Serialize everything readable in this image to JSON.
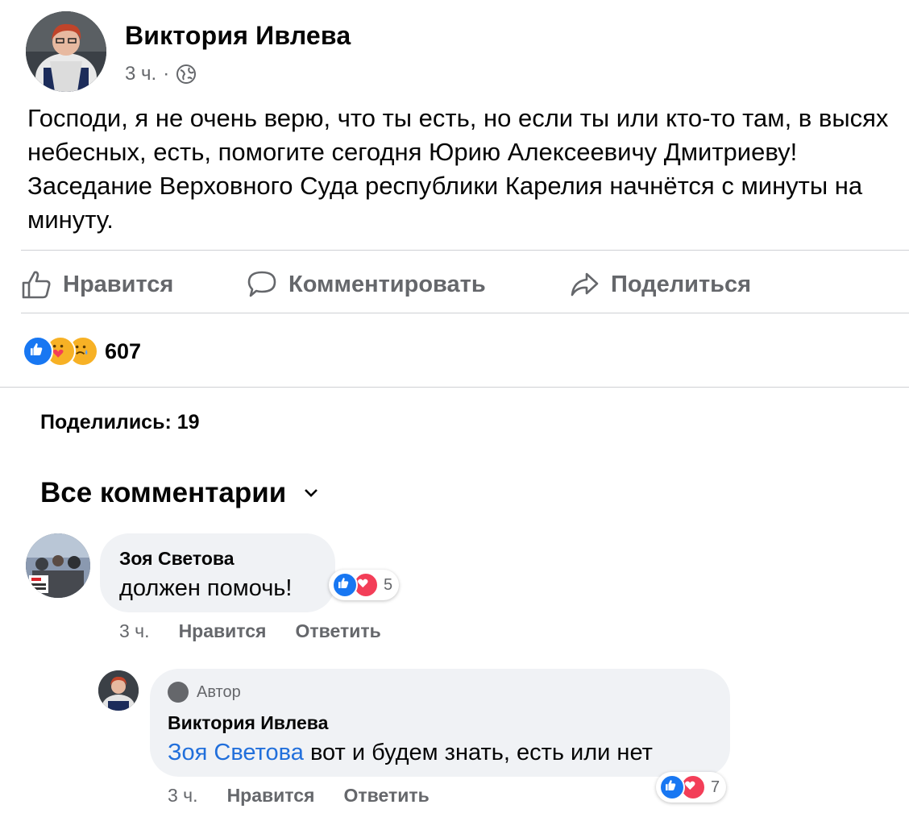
{
  "post": {
    "author": "Виктория Ивлева",
    "time": "3 ч.",
    "separator": "·",
    "privacy_icon": "globe-icon",
    "text": "Господи, я не очень верю, что ты есть, но если ты или кто-то там, в высях небесных, есть, помогите сегодня Юрию Алексеевичу Дмитриеву! Заседание Верховного Суда республики Карелия начнётся с минуты на минуту."
  },
  "actions": {
    "like": "Нравится",
    "comment": "Комментировать",
    "share": "Поделиться"
  },
  "reactions": {
    "icons": [
      "like-reaction-icon",
      "care-reaction-icon",
      "sad-reaction-icon"
    ],
    "count": "607"
  },
  "shares": "Поделились: 19",
  "comments_header": "Все комментарии",
  "comments": [
    {
      "name": "Зоя Светова",
      "text": "должен помочь!",
      "reactions_count": "5",
      "time": "3 ч.",
      "like": "Нравится",
      "reply": "Ответить"
    }
  ],
  "reply": {
    "badge": "Автор",
    "name": "Виктория Ивлева",
    "mention": "Зоя Светова",
    "text": " вот и будем знать, есть или нет",
    "reactions_count": "7",
    "time": "3 ч.",
    "like": "Нравится",
    "reply": "Ответить"
  },
  "colors": {
    "like_blue": "#1877f2",
    "love_red": "#f33e58",
    "secondary_text": "#65676b",
    "mention_blue": "#216fdb",
    "bubble_bg": "#f0f2f5"
  }
}
